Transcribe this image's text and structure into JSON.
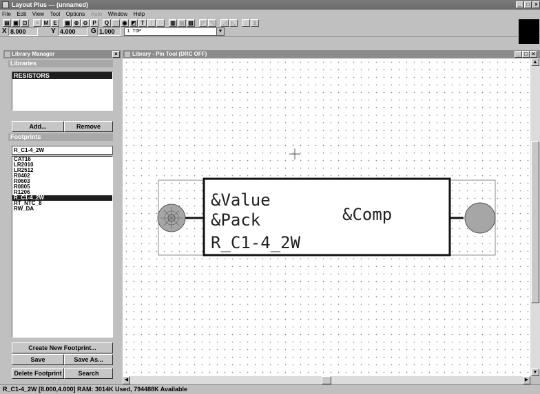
{
  "window": {
    "title": "Layout Plus — (unnamed)"
  },
  "menu": [
    "File",
    "Edit",
    "View",
    "Tool",
    "Options",
    "Auto",
    "Window",
    "Help"
  ],
  "menu_disabled": [
    "Auto"
  ],
  "coords": {
    "x_label": "X",
    "x_value": "8.000",
    "y_label": "Y",
    "y_value": "4.000",
    "g_label": "G",
    "g_value": "1.000"
  },
  "layer": {
    "value": "1 TOP"
  },
  "library_manager": {
    "title": "Library Manager",
    "libraries_header": "Libraries",
    "libraries": [
      {
        "name": "RESISTORS",
        "selected": true
      }
    ],
    "add_label": "Add...",
    "remove_label": "Remove",
    "footprints_header": "Footprints",
    "filter_value": "R_C1-4_2W",
    "footprints": [
      "CAT16",
      "LR2010",
      "LR2512",
      "R0402",
      "R0603",
      "R0805",
      "R1206",
      "R_C1-4_2W",
      "RT_NTC_8",
      "RW_DA"
    ],
    "selected_footprint": "R_C1-4_2W",
    "create_label": "Create New Footprint...",
    "save_label": "Save",
    "save_as_label": "Save As...",
    "delete_label": "Delete Footprint",
    "search_label": "Search"
  },
  "library_window": {
    "title": "Library - Pin Tool (DRC OFF)",
    "texts": {
      "value": "&Value",
      "pack": "&Pack",
      "name": "R_C1-4_2W",
      "comp": "&Comp"
    }
  },
  "status": {
    "text": "R_C1-4_2W  [8.000,4.000]  RAM: 3014K Used, 794488K Available"
  },
  "colors": {
    "selection": "#1e1e1e",
    "title_bar": "#8c8c8c",
    "pad_fill": "#a6a6a6",
    "canvas": "#ffffff"
  },
  "icons": [
    "app-icon",
    "minimize-icon",
    "maximize-icon",
    "close-icon",
    "library-manager-icon",
    "library-window-icon",
    "cursor-crosshair-icon"
  ]
}
